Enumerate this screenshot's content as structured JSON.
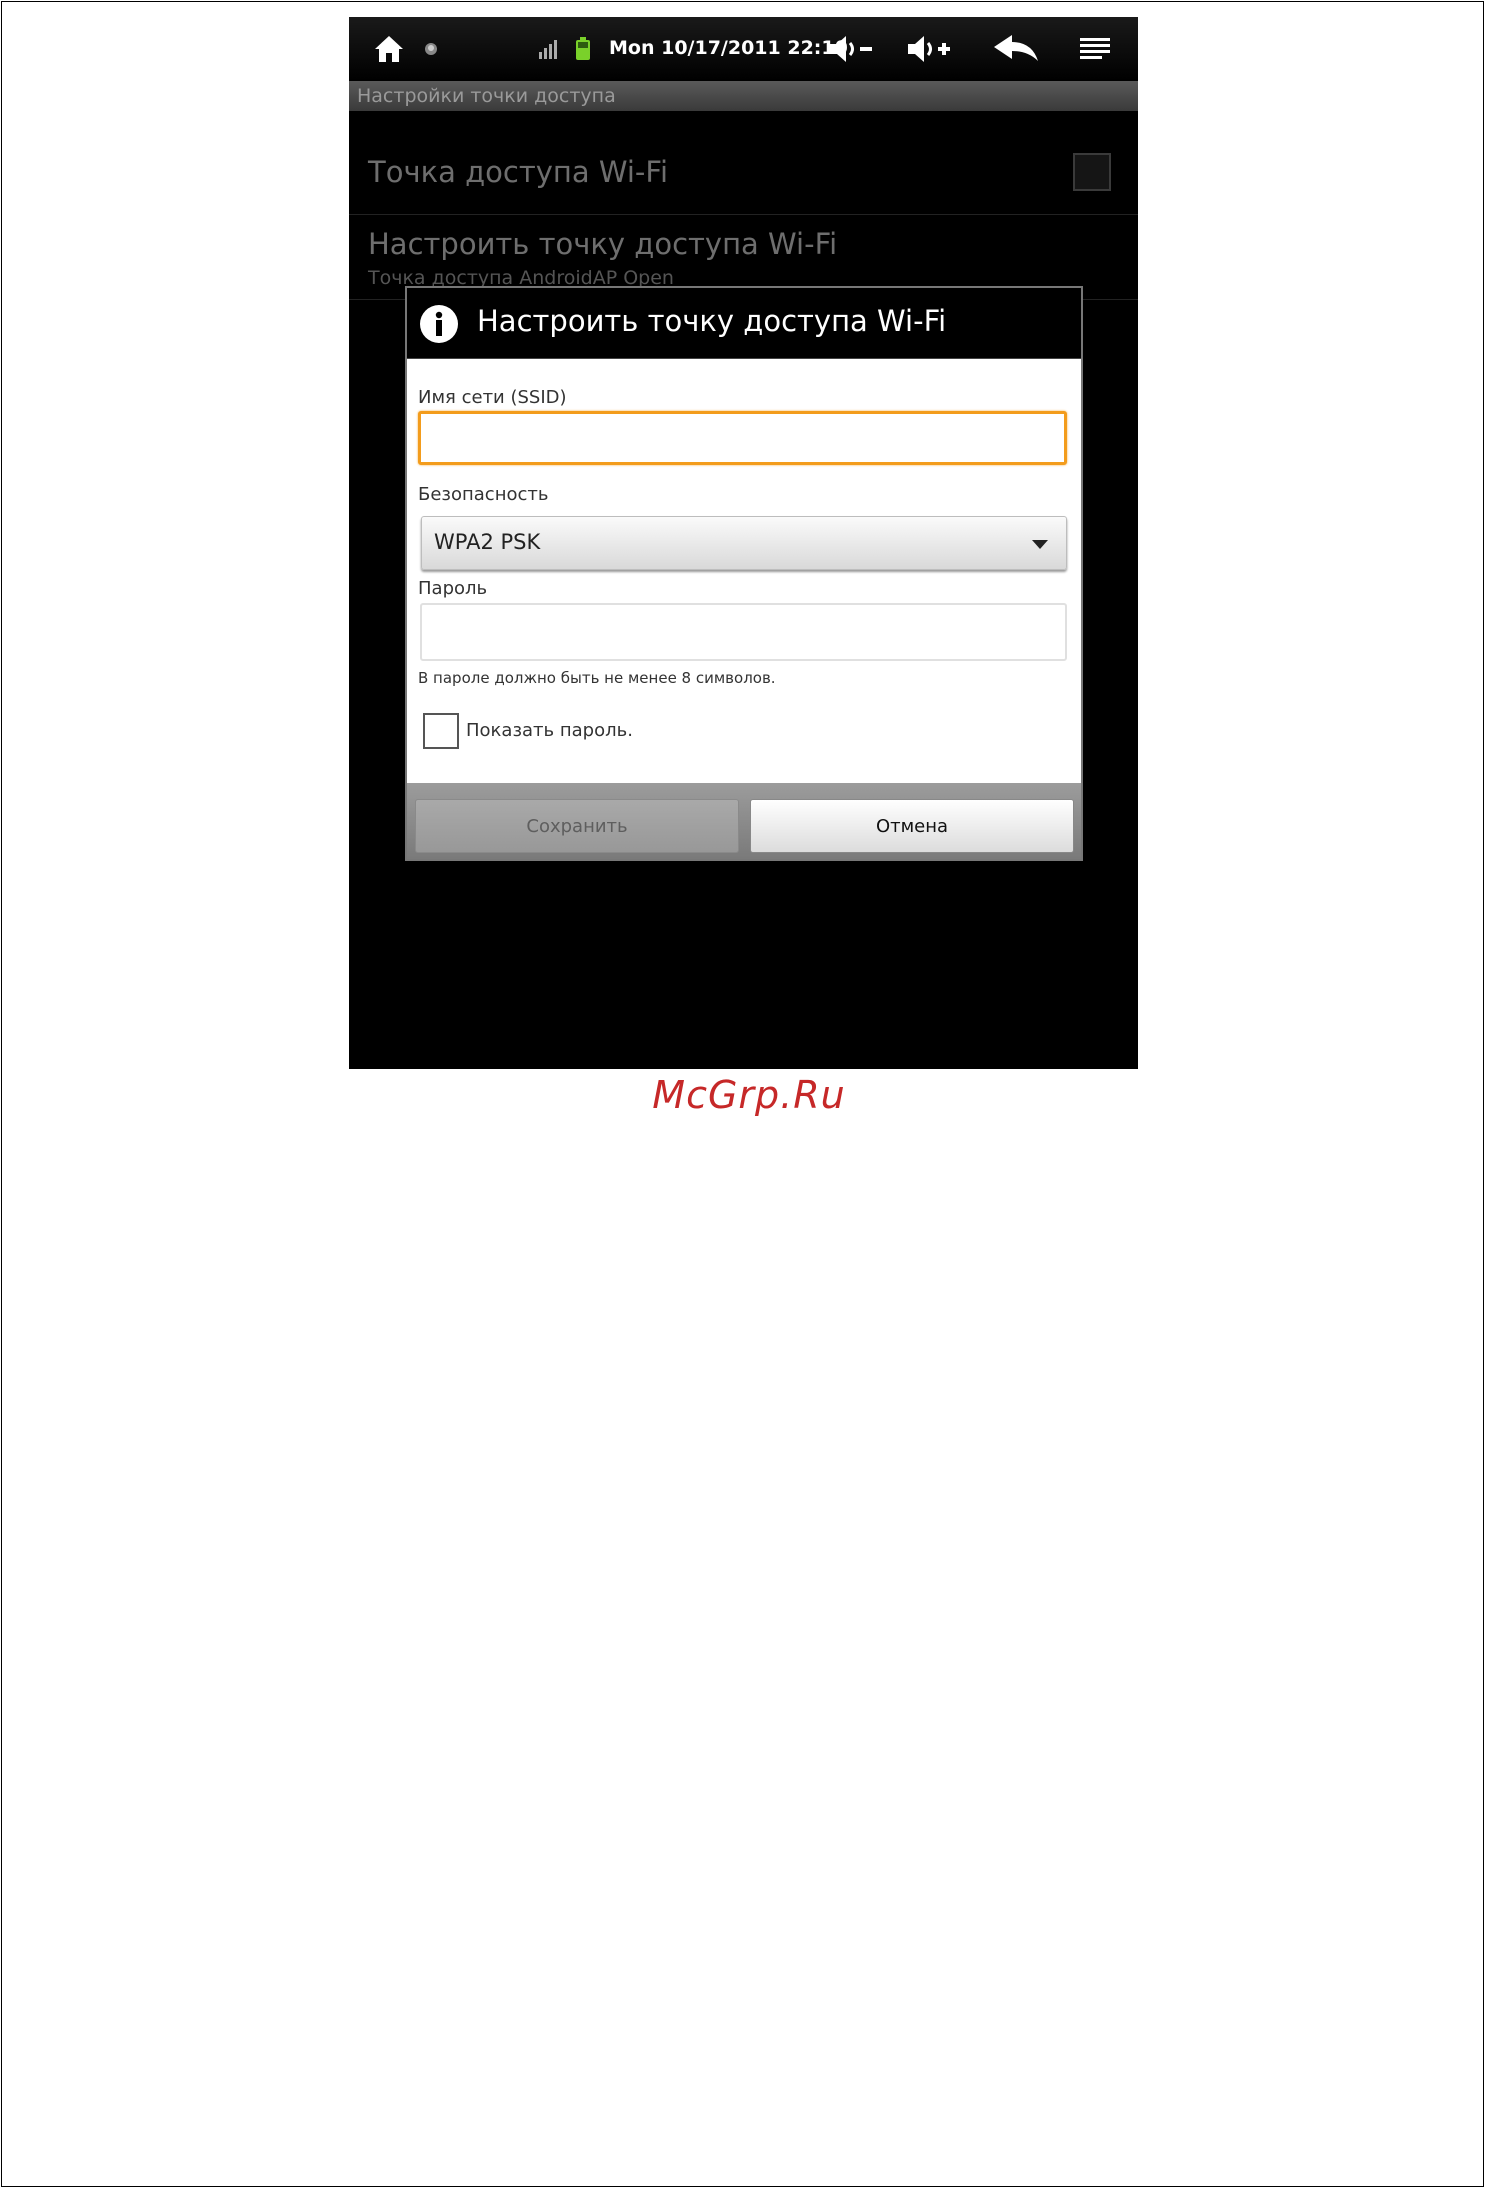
{
  "status_bar": {
    "clock": "Mon 10/17/2011 22:10",
    "icons": [
      "home-icon",
      "notification-dot-icon",
      "signal-icon",
      "battery-icon",
      "volume-down-icon",
      "volume-up-icon",
      "back-icon",
      "menu-icon"
    ],
    "battery_color": "#7ad12a"
  },
  "screen": {
    "title": "Настройки точки доступа",
    "prefs": [
      {
        "title": "Точка доступа Wi-Fi",
        "checked": false
      },
      {
        "title": "Настроить точку доступа Wi-Fi",
        "summary": "Точка доступа AndroidAP Open"
      }
    ]
  },
  "dialog": {
    "title": "Настроить точку доступа Wi-Fi",
    "title_icon": "info-icon",
    "ssid_label": "Имя сети (SSID)",
    "ssid_value": "",
    "security_label": "Безопасность",
    "security_value": "WPA2 PSK",
    "password_label": "Пароль",
    "password_value": "",
    "password_hint": "В пароле должно быть не менее 8 символов.",
    "show_password_label": "Показать пароль.",
    "show_password_checked": false,
    "save_label": "Сохранить",
    "cancel_label": "Отмена",
    "focus_color": "#f39c1c"
  },
  "watermark": "McGrp.Ru"
}
